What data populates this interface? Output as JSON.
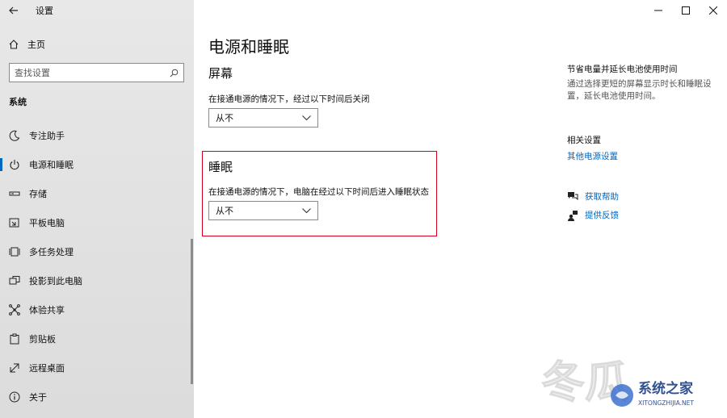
{
  "app": {
    "title": "设置"
  },
  "sidebar": {
    "home_label": "主页",
    "search_placeholder": "查找设置",
    "section_label": "系统",
    "items": [
      {
        "label": "专注助手",
        "icon": "moon-icon"
      },
      {
        "label": "电源和睡眠",
        "icon": "power-icon",
        "active": true
      },
      {
        "label": "存储",
        "icon": "storage-icon"
      },
      {
        "label": "平板电脑",
        "icon": "tablet-icon"
      },
      {
        "label": "多任务处理",
        "icon": "multitask-icon"
      },
      {
        "label": "投影到此电脑",
        "icon": "project-icon"
      },
      {
        "label": "体验共享",
        "icon": "share-icon"
      },
      {
        "label": "剪贴板",
        "icon": "clipboard-icon"
      },
      {
        "label": "远程桌面",
        "icon": "remote-desktop-icon"
      },
      {
        "label": "关于",
        "icon": "info-icon"
      }
    ]
  },
  "main": {
    "title": "电源和睡眠",
    "screen": {
      "heading": "屏幕",
      "desc": "在接通电源的情况下，经过以下时间后关闭",
      "value": "从不"
    },
    "sleep": {
      "heading": "睡眠",
      "desc": "在接通电源的情况下，电脑在经过以下时间后进入睡眠状态",
      "value": "从不"
    }
  },
  "right": {
    "tip_title": "节省电量并延长电池使用时间",
    "tip_desc": "通过选择更短的屏幕显示时长和睡眠设置，延长电池使用时间。",
    "related_title": "相关设置",
    "related_link": "其他电源设置",
    "help": "获取帮助",
    "feedback": "提供反馈"
  },
  "watermark": {
    "text": "系统之家",
    "url": "XITONGZHIJIA.NET"
  },
  "colors": {
    "accent": "#0067c0",
    "highlight": "#d0021b"
  }
}
